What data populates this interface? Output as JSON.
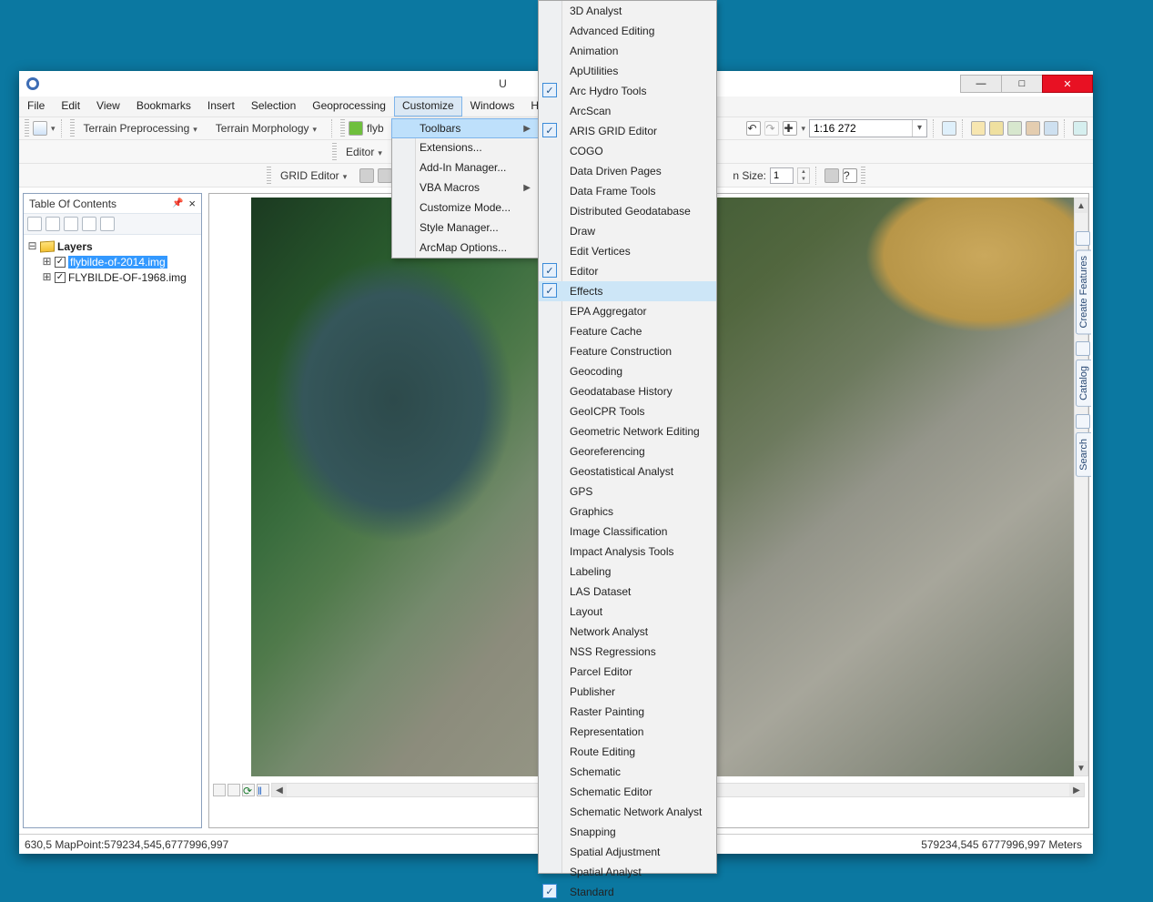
{
  "window": {
    "title": "U"
  },
  "menubar": [
    "File",
    "Edit",
    "View",
    "Bookmarks",
    "Insert",
    "Selection",
    "Geoprocessing",
    "Customize",
    "Windows",
    "Help"
  ],
  "active_menu_index": 7,
  "toolbar1": {
    "terrain1": "Terrain Preprocessing",
    "terrain2": "Terrain Morphology",
    "fly_label": "flyb"
  },
  "toolbar_right": {
    "scale": "1:16 272"
  },
  "toolbar2": {
    "editor": "Editor",
    "grid": "GRID Editor",
    "size_label": "n Size:",
    "size_value": "1"
  },
  "toc": {
    "title": "Table Of Contents",
    "root": "Layers",
    "items": [
      {
        "label": "flybilde-of-2014.img",
        "checked": true,
        "selected": true
      },
      {
        "label": "FLYBILDE-OF-1968.img",
        "checked": true,
        "selected": false
      }
    ]
  },
  "dock_tabs": [
    "Create Features",
    "Catalog",
    "Search"
  ],
  "status": {
    "left": "630,5 MapPoint:579234,545,6777996,997",
    "right": "579234,545  6777996,997 Meters"
  },
  "customize_menu": {
    "items": [
      {
        "label": "Toolbars",
        "submenu": true,
        "highlight": true
      },
      {
        "label": "Extensions..."
      },
      {
        "label": "Add-In Manager..."
      },
      {
        "label": "VBA Macros",
        "submenu": true
      },
      {
        "label": "Customize Mode..."
      },
      {
        "label": "Style Manager..."
      },
      {
        "label": "ArcMap Options..."
      }
    ]
  },
  "toolbars_menu": {
    "items": [
      {
        "label": "3D Analyst"
      },
      {
        "label": "Advanced Editing"
      },
      {
        "label": "Animation"
      },
      {
        "label": "ApUtilities"
      },
      {
        "label": "Arc Hydro Tools",
        "checked": true
      },
      {
        "label": "ArcScan"
      },
      {
        "label": "ARIS GRID Editor",
        "checked": true
      },
      {
        "label": "COGO"
      },
      {
        "label": "Data Driven Pages"
      },
      {
        "label": "Data Frame Tools"
      },
      {
        "label": "Distributed Geodatabase"
      },
      {
        "label": "Draw"
      },
      {
        "label": "Edit Vertices"
      },
      {
        "label": "Editor",
        "checked": true
      },
      {
        "label": "Effects",
        "hover": true,
        "checked": true
      },
      {
        "label": "EPA Aggregator"
      },
      {
        "label": "Feature Cache"
      },
      {
        "label": "Feature Construction"
      },
      {
        "label": "Geocoding"
      },
      {
        "label": "Geodatabase History"
      },
      {
        "label": "GeoICPR Tools"
      },
      {
        "label": "Geometric Network Editing"
      },
      {
        "label": "Georeferencing"
      },
      {
        "label": "Geostatistical Analyst"
      },
      {
        "label": "GPS"
      },
      {
        "label": "Graphics"
      },
      {
        "label": "Image Classification"
      },
      {
        "label": "Impact Analysis Tools"
      },
      {
        "label": "Labeling"
      },
      {
        "label": "LAS Dataset"
      },
      {
        "label": "Layout"
      },
      {
        "label": "Network Analyst"
      },
      {
        "label": "NSS Regressions"
      },
      {
        "label": "Parcel Editor"
      },
      {
        "label": "Publisher"
      },
      {
        "label": "Raster Painting"
      },
      {
        "label": "Representation"
      },
      {
        "label": "Route Editing"
      },
      {
        "label": "Schematic"
      },
      {
        "label": "Schematic Editor"
      },
      {
        "label": "Schematic Network Analyst"
      },
      {
        "label": "Snapping"
      },
      {
        "label": "Spatial Adjustment"
      },
      {
        "label": "Spatial Analyst"
      },
      {
        "label": "Standard",
        "checked": true
      }
    ]
  }
}
